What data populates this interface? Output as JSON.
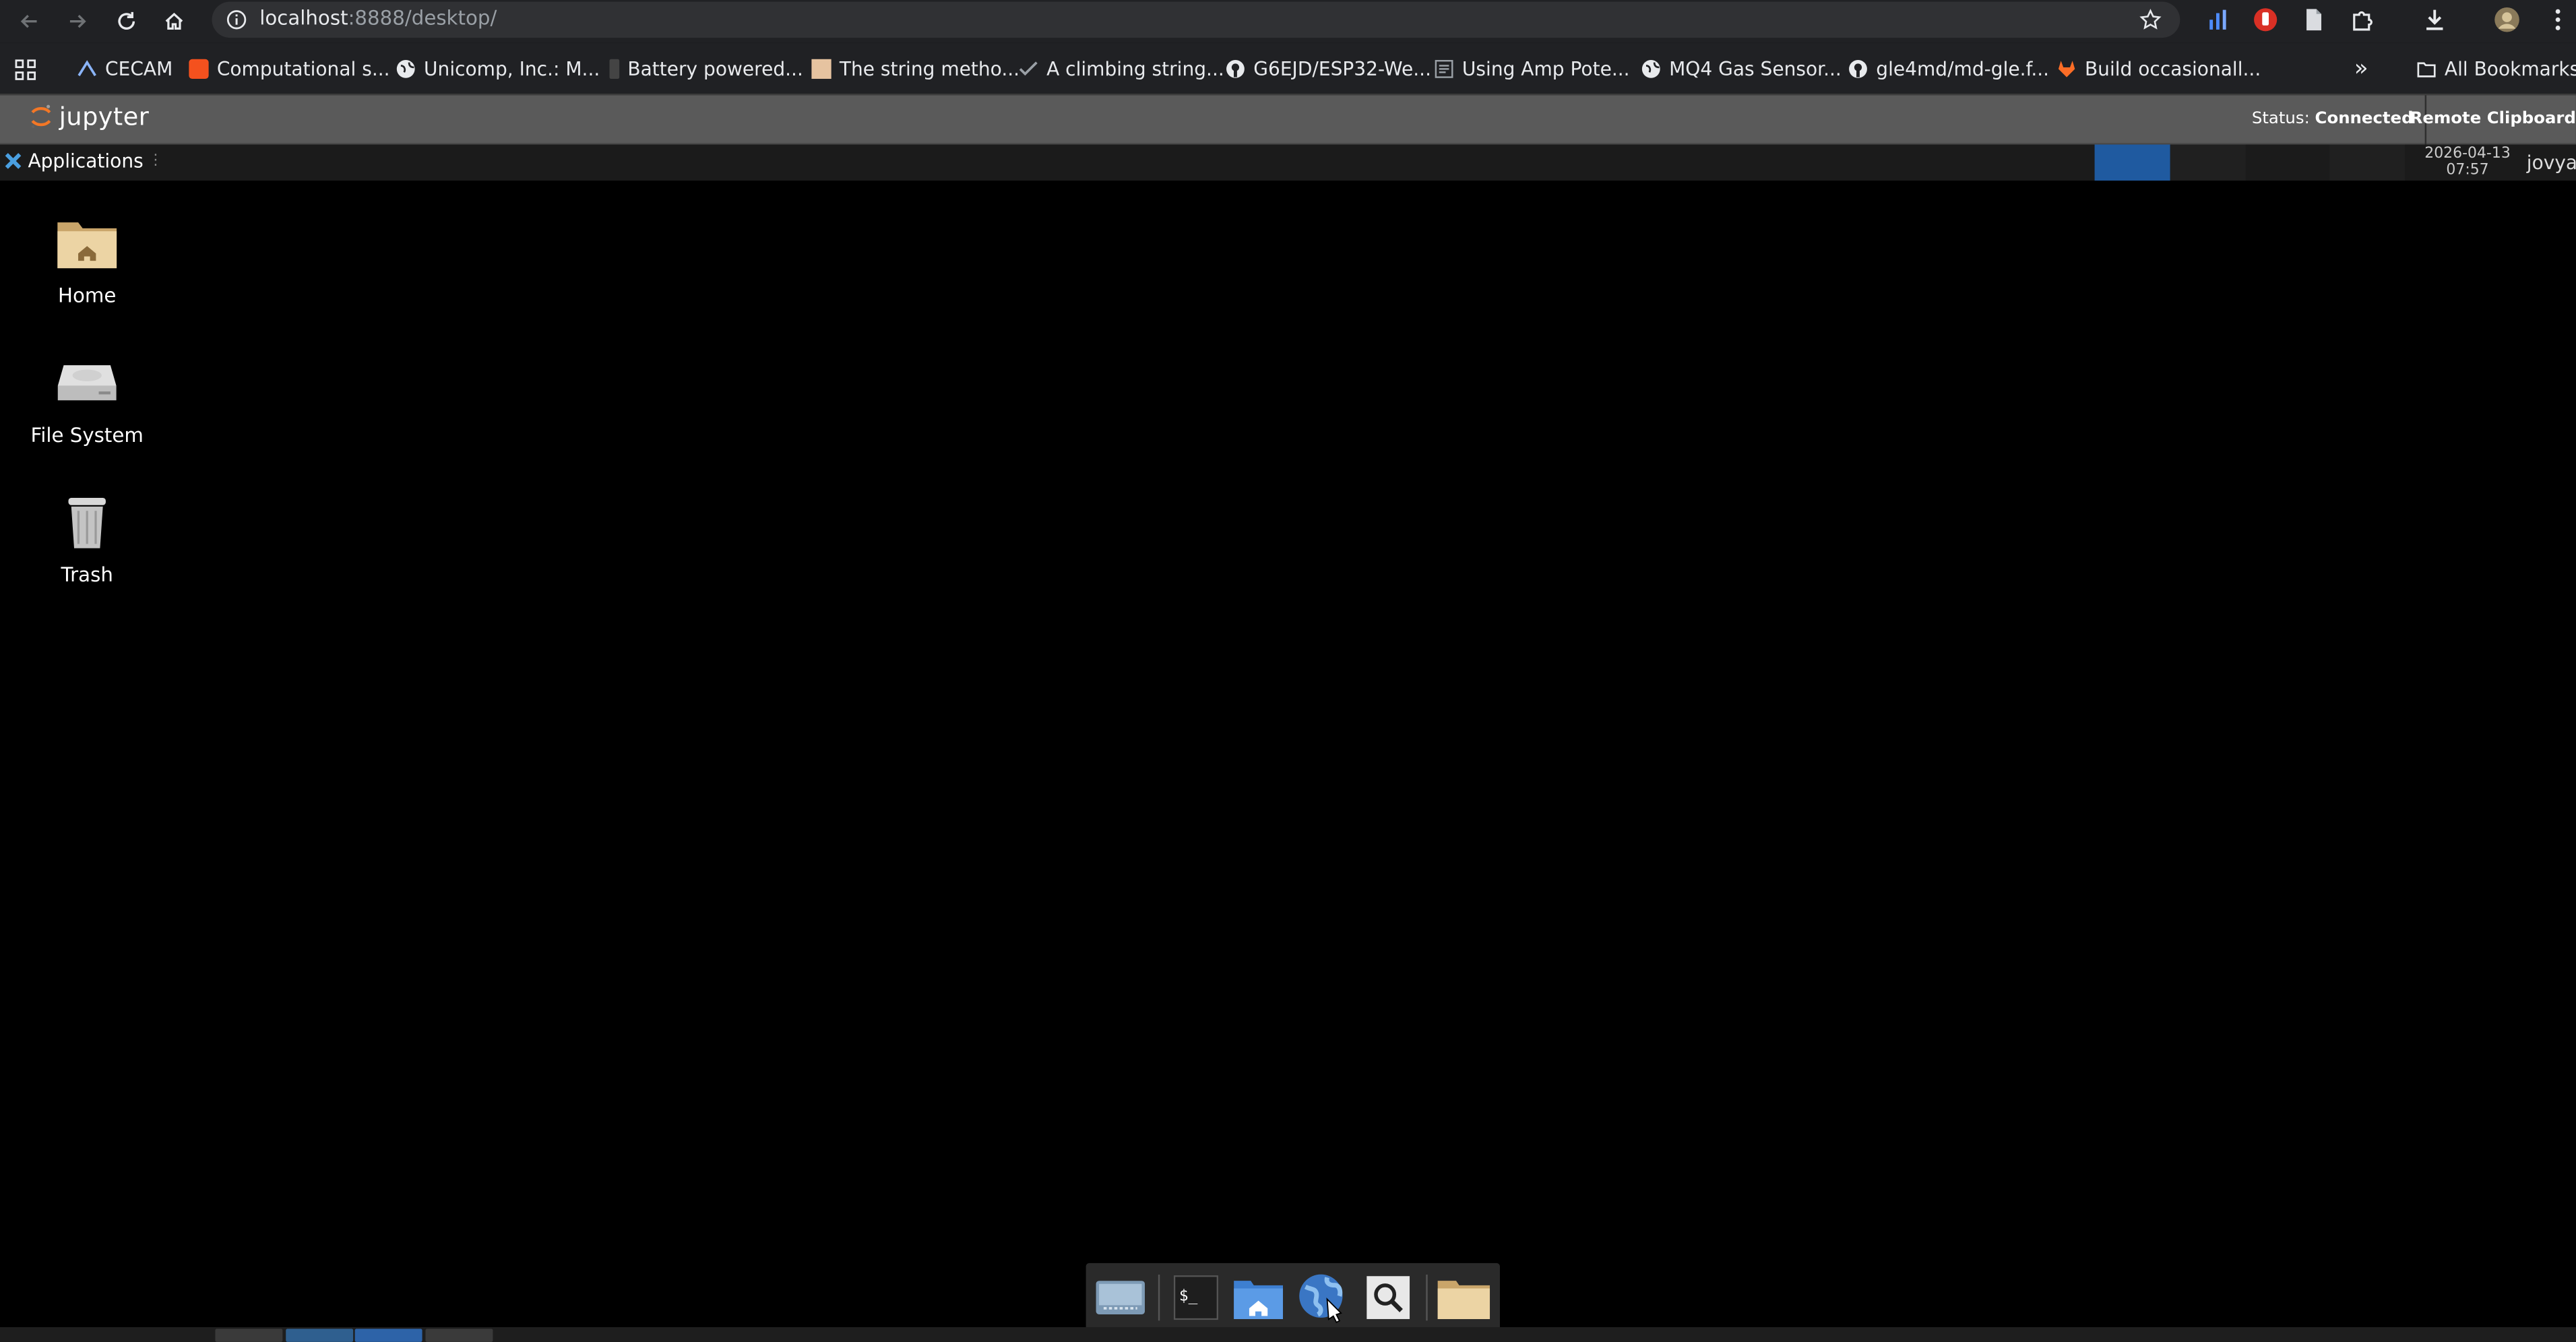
{
  "browser": {
    "url_host": "localhost",
    "url_path": ":8888/desktop/",
    "bookmarks": [
      {
        "label": "CECAM"
      },
      {
        "label": "Computational s..."
      },
      {
        "label": "Unicomp, Inc.: M..."
      },
      {
        "label": "Battery powered..."
      },
      {
        "label": "The string metho..."
      },
      {
        "label": "A climbing string..."
      },
      {
        "label": "G6EJD/ESP32-We..."
      },
      {
        "label": "Using Amp Pote..."
      },
      {
        "label": "MQ4 Gas Sensor..."
      },
      {
        "label": "gle4md/md-gle.f..."
      },
      {
        "label": "Build occasionall..."
      }
    ],
    "more_label": "»",
    "all_bookmarks_label": "All Bookmarks"
  },
  "jupyter": {
    "logo_text": "jupyter",
    "status_label": "Status:",
    "status_value": "Connected",
    "clipboard_label": "Remote Clipboard"
  },
  "panel": {
    "applications_label": "Applications",
    "clock_date": "2026-04-13",
    "clock_time": "07:57",
    "user": "jovya",
    "accent": "#1f5aa0"
  },
  "desktop": {
    "icons": [
      {
        "label": "Home",
        "icon": "home-folder-icon"
      },
      {
        "label": "File System",
        "icon": "drive-icon"
      },
      {
        "label": "Trash",
        "icon": "trash-icon"
      }
    ]
  },
  "dock": {
    "items": [
      "show-desktop-icon",
      "terminal-icon",
      "home-folder-icon",
      "web-browser-icon",
      "search-icon",
      "folder-icon"
    ]
  }
}
